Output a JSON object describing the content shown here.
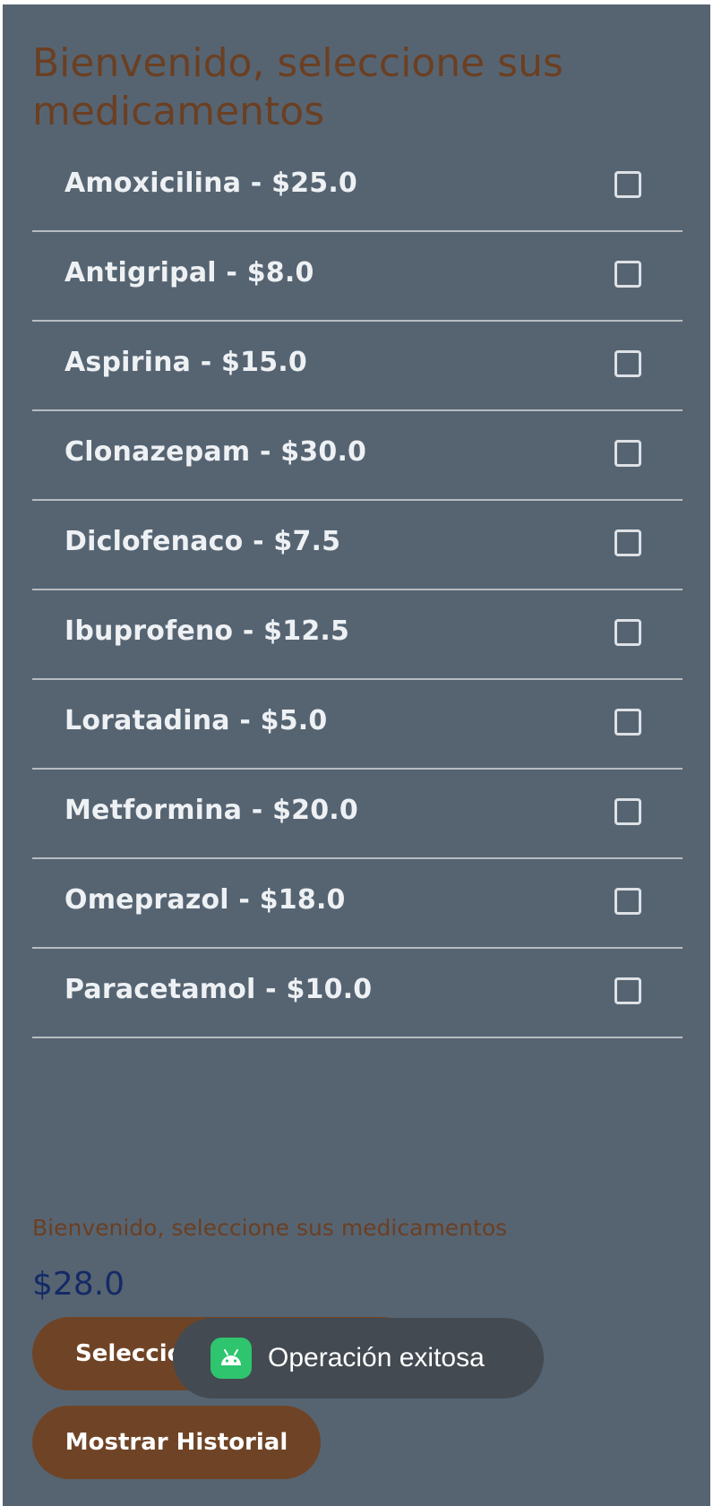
{
  "page": {
    "title": "Bienvenido, seleccione sus medicamentos"
  },
  "medications": [
    {
      "label": "Amoxicilina - $25.0",
      "checked": false
    },
    {
      "label": "Antigripal - $8.0",
      "checked": false
    },
    {
      "label": "Aspirina - $15.0",
      "checked": false
    },
    {
      "label": "Clonazepam - $30.0",
      "checked": false
    },
    {
      "label": "Diclofenaco - $7.5",
      "checked": false
    },
    {
      "label": "Ibuprofeno - $12.5",
      "checked": false
    },
    {
      "label": "Loratadina - $5.0",
      "checked": false
    },
    {
      "label": "Metformina - $20.0",
      "checked": false
    },
    {
      "label": "Omeprazol - $18.0",
      "checked": false
    },
    {
      "label": "Paracetamol - $10.0",
      "checked": false
    }
  ],
  "footer": {
    "label": "Bienvenido, seleccione sus medicamentos",
    "total": "$28.0"
  },
  "buttons": {
    "select_label": "Seleccionar",
    "history_label": "Mostrar Historial"
  },
  "toast": {
    "icon": "android-icon",
    "message": "Operación exitosa"
  },
  "colors": {
    "background": "#566472",
    "title_brown": "#6b3f22",
    "button_brown": "#6f4426",
    "total_blue": "#152a66",
    "toast_bg": "#434a51",
    "android_green": "#2ec56e"
  }
}
